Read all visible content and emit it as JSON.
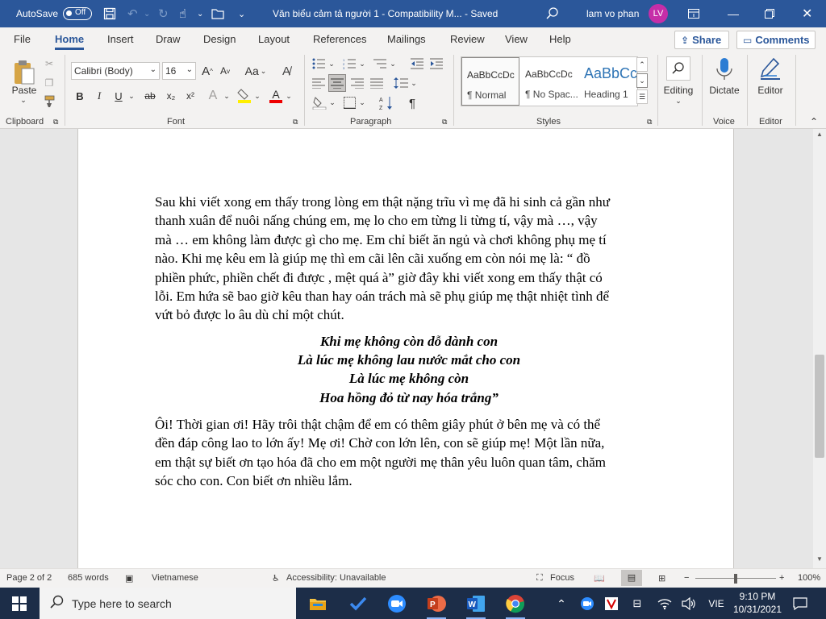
{
  "titlebar": {
    "autosave_label": "AutoSave",
    "autosave_state": "Off",
    "title": "Văn biểu cảm tả người 1  -  Compatibility M...  -  Saved",
    "user_name": "lam vo phan",
    "user_initials": "LV"
  },
  "tabs": [
    "File",
    "Home",
    "Insert",
    "Draw",
    "Design",
    "Layout",
    "References",
    "Mailings",
    "Review",
    "View",
    "Help"
  ],
  "tab_actions": {
    "share": "Share",
    "comments": "Comments"
  },
  "ribbon": {
    "clipboard": {
      "paste": "Paste",
      "label": "Clipboard"
    },
    "font": {
      "name": "Calibri (Body)",
      "size": "16",
      "label": "Font",
      "buttons": {
        "bold": "B",
        "italic": "I",
        "underline": "U",
        "strike": "ab",
        "sub": "x₂",
        "sup": "x²",
        "grow": "A",
        "shrink": "A",
        "case": "Aa",
        "effects": "A",
        "color": "A"
      }
    },
    "paragraph": {
      "label": "Paragraph",
      "pilcrow": "¶"
    },
    "styles": {
      "label": "Styles",
      "items": [
        {
          "sample": "AaBbCcDc",
          "name": "¶ Normal"
        },
        {
          "sample": "AaBbCcDc",
          "name": "¶ No Spac..."
        },
        {
          "sample": "AaBbCc",
          "name": "Heading 1"
        }
      ]
    },
    "editing": {
      "label": "Editing"
    },
    "voice": {
      "dictate": "Dictate",
      "label": "Voice"
    },
    "editor": {
      "editor": "Editor",
      "label": "Editor"
    }
  },
  "document": {
    "paragraph1": [
      "Sau khi viết xong em thấy trong lòng em thật nặng trĩu vì mẹ đã hi sinh cả gần như",
      "thanh xuân để nuôi nấng chúng em, mẹ lo cho em từng li từng tí, vậy mà …, vậy",
      "mà … em không làm được gì cho mẹ. Em chỉ biết ăn ngủ và chơi không phụ mẹ tí",
      "nào. Khi mẹ kêu em là giúp mẹ thì em cãi lên cãi xuống em còn nói mẹ là: “ đồ",
      "phiền phức, phiền chết đi được , mệt quá à” giờ đây khi viết xong em thấy thật có",
      "lỗi. Em hứa sẽ bao giờ kêu than  hay oán trách mà sẽ phụ giúp mẹ thật nhiệt tình để",
      "vứt bỏ được lo âu dù chỉ một chút."
    ],
    "poem": [
      "Khi mẹ không còn dỗ dành con",
      "Là lúc mẹ không lau nước mắt cho con",
      "Là lúc mẹ không còn",
      "Hoa hồng đỏ từ nay hóa trắng”"
    ],
    "paragraph2": [
      "Ôi! Thời gian ơi! Hãy trôi thật chậm để em có thêm giây phút ở bên mẹ và có thể",
      "đền đáp công lao to lớn ấy! Mẹ ơi! Chờ con lớn lên, con sẽ giúp mẹ! Một lần nữa,",
      "em thật sự biết ơn tạo hóa đã cho em một người mẹ thân yêu luôn quan tâm, chăm",
      "sóc cho con. Con biết ơn nhiều lắm."
    ]
  },
  "statusbar": {
    "page": "Page 2 of 2",
    "words": "685 words",
    "language": "Vietnamese",
    "accessibility": "Accessibility: Unavailable",
    "focus": "Focus",
    "zoom": "100%"
  },
  "taskbar": {
    "search_placeholder": "Type here to search",
    "language": "VIE",
    "time": "9:10 PM",
    "date": "10/31/2021"
  }
}
